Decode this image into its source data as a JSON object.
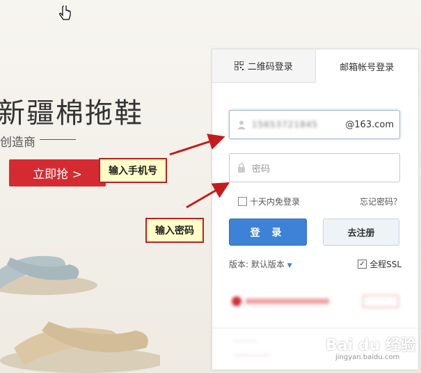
{
  "banner": {
    "headline": "新疆棉拖鞋",
    "subline": "创造商",
    "cta": "立即抢 >"
  },
  "login": {
    "tabs": [
      {
        "label": "二维码登录"
      },
      {
        "label": "邮箱帐号登录"
      }
    ],
    "username": {
      "value": "15653721845",
      "suffix": "@163.com"
    },
    "password": {
      "placeholder": "密码"
    },
    "remember": "十天内免登录",
    "forgot": "忘记密码？",
    "login_button": "登 录",
    "register_button": "去注册",
    "version": "版本: 默认版本",
    "ssl": "全程SSL"
  },
  "annotations": {
    "phone": "输入手机号",
    "password": "输入密码"
  },
  "watermark": {
    "brand": "Bai du 经验",
    "url": "jingyan.baidu.com"
  },
  "colors": {
    "accent_red": "#d42b33",
    "login_blue": "#3d82d6",
    "callout_bg": "#ffffc8",
    "arrow_red": "#c61b1b"
  }
}
